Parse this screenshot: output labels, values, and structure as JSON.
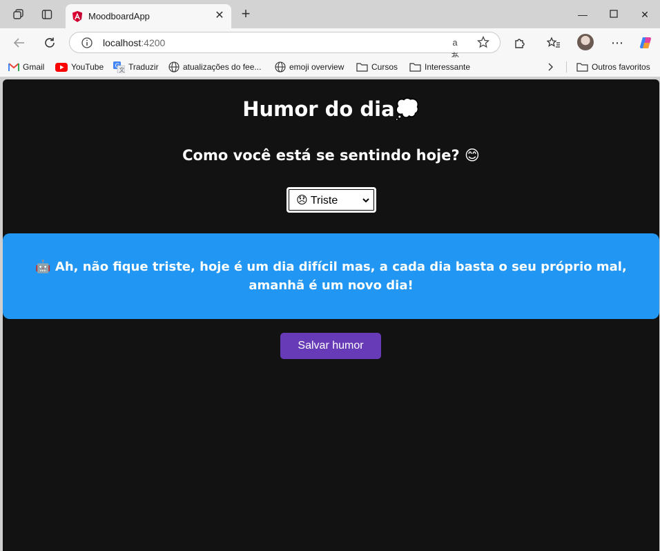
{
  "browser": {
    "tab": {
      "title": "MoodboardApp"
    },
    "address": {
      "host": "localhost",
      "port": ":4200"
    },
    "bookmarks": [
      {
        "label": "Gmail",
        "icon": "gmail-icon"
      },
      {
        "label": "YouTube",
        "icon": "youtube-icon"
      },
      {
        "label": "Traduzir",
        "icon": "translate-icon"
      },
      {
        "label": "atualizações do fee...",
        "icon": "globe-icon"
      },
      {
        "label": "emoji overview",
        "icon": "globe-icon"
      },
      {
        "label": "Cursos",
        "icon": "folder-icon"
      },
      {
        "label": "Interessante",
        "icon": "folder-icon"
      }
    ],
    "other_favorites": "Outros favoritos",
    "reader_glyph": "aあ"
  },
  "app": {
    "title": "Humor do dia",
    "title_emoji": "💭",
    "question": "Como você está se sentindo hoje? 😊",
    "mood_select": {
      "selected": "😞 Triste"
    },
    "message": "🤖 Ah, não fique triste, hoje é um dia difícil mas, a cada dia basta o seu próprio mal, amanhã é um novo dia!",
    "save_label": "Salvar humor"
  },
  "colors": {
    "page_bg": "#121212",
    "message_bg": "#2196f3",
    "button_bg": "#673ab7"
  }
}
